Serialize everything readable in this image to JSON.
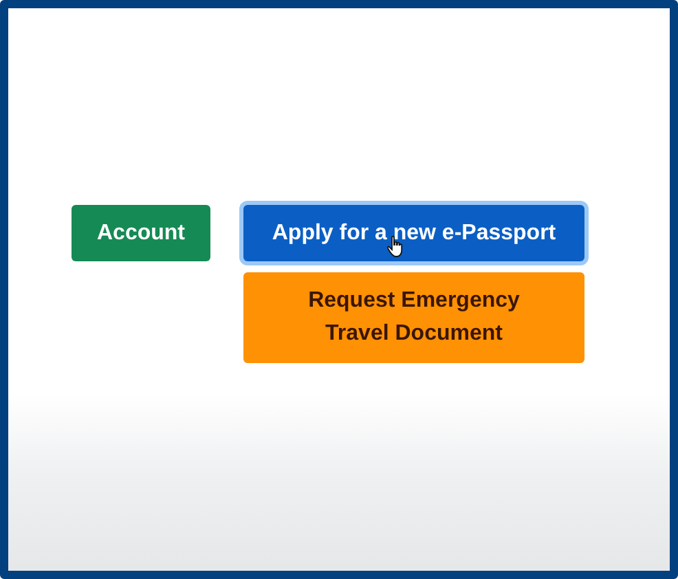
{
  "buttons": [
    {
      "label": "Account",
      "kind": "light-text",
      "color": "#168a55",
      "focused": false
    },
    {
      "label": "Apply for a new e-Passport",
      "kind": "light-text",
      "color": "#0b5fc4",
      "focused": true
    },
    {
      "label": "Request Emergency Travel Document",
      "kind": "dark-text",
      "color": "#ff9104",
      "focused": false
    }
  ]
}
